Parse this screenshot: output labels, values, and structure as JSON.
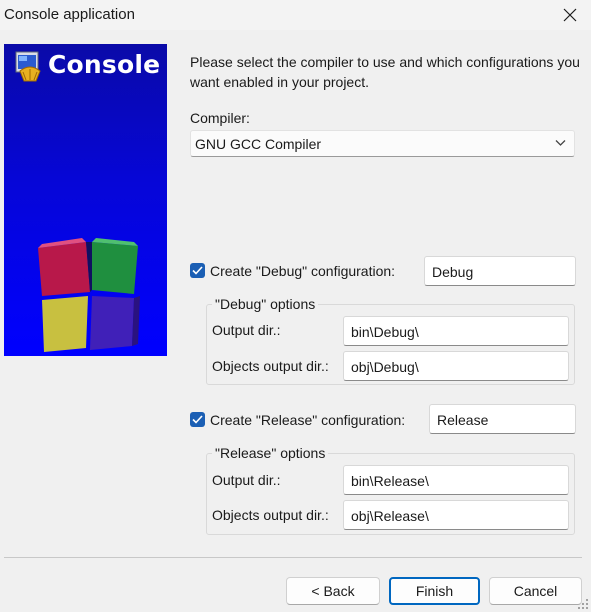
{
  "window": {
    "title": "Console application"
  },
  "banner": {
    "title": "Console"
  },
  "intro": "Please select the compiler to use and which configurations you want enabled in your project.",
  "compiler": {
    "label": "Compiler:",
    "selected": "GNU GCC Compiler"
  },
  "debug": {
    "checkbox_label": "Create \"Debug\" configuration:",
    "checked": true,
    "name": "Debug",
    "group_title": "\"Debug\" options",
    "output_dir_label": "Output dir.:",
    "output_dir": "bin\\Debug\\",
    "objects_dir_label": "Objects output dir.:",
    "objects_dir": "obj\\Debug\\"
  },
  "release": {
    "checkbox_label": "Create \"Release\" configuration:",
    "checked": true,
    "name": "Release",
    "group_title": "\"Release\" options",
    "output_dir_label": "Output dir.:",
    "output_dir": "bin\\Release\\",
    "objects_dir_label": "Objects output dir.:",
    "objects_dir": "obj\\Release\\"
  },
  "buttons": {
    "back": "< Back",
    "finish": "Finish",
    "cancel": "Cancel"
  },
  "colors": {
    "accent": "#1b5fb4",
    "banner_blue": "#0000ff",
    "default_button_border": "#0067c0"
  },
  "icons": [
    "close-icon",
    "console-app-icon",
    "chevron-down-icon",
    "checkmark-icon",
    "codeblocks-logo-icon",
    "resize-grip-icon"
  ]
}
